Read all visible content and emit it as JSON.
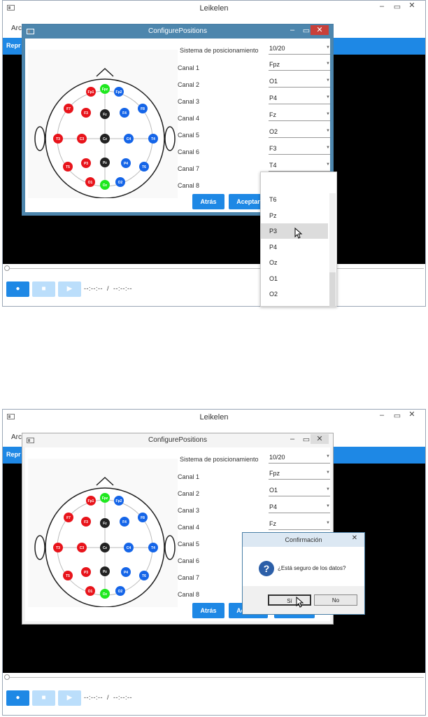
{
  "app": {
    "title": "Leikelen",
    "menu_label": "Arc",
    "blue_label": "Repr"
  },
  "window_controls": {
    "minimize": "–",
    "maximize": "▭",
    "close": "✕"
  },
  "player": {
    "time_current": "--:--:--",
    "time_sep": "/",
    "time_total": "--:--:--"
  },
  "config": {
    "title": "ConfigurePositions",
    "system_label": "Sistema de posicionamiento",
    "system_value": "10/20",
    "channels": [
      {
        "label": "Canal 1",
        "value": "Fpz"
      },
      {
        "label": "Canal 2",
        "value": "O1"
      },
      {
        "label": "Canal 3",
        "value": "P4"
      },
      {
        "label": "Canal 4",
        "value": "Fz"
      },
      {
        "label": "Canal 5",
        "value": "O2"
      },
      {
        "label": "Canal 6",
        "value": "F3"
      },
      {
        "label": "Canal 7",
        "value": "T4"
      },
      {
        "label": "Canal 8",
        "value": ""
      }
    ],
    "back_button": "Atrás",
    "accept_button": "Aceptar",
    "accept_button_short": "Ac"
  },
  "dropdown_options": [
    "T6",
    "Pz",
    "P3",
    "P4",
    "Oz",
    "O1",
    "O2"
  ],
  "dropdown_highlighted": "P3",
  "electrodes": [
    {
      "name": "Fp1",
      "color": "red"
    },
    {
      "name": "Fpz",
      "color": "green"
    },
    {
      "name": "Fp2",
      "color": "blue"
    },
    {
      "name": "F7",
      "color": "red"
    },
    {
      "name": "F3",
      "color": "red"
    },
    {
      "name": "Fz",
      "color": "black"
    },
    {
      "name": "F4",
      "color": "blue"
    },
    {
      "name": "F8",
      "color": "blue"
    },
    {
      "name": "T3",
      "color": "red"
    },
    {
      "name": "C3",
      "color": "red"
    },
    {
      "name": "Cz",
      "color": "black"
    },
    {
      "name": "C4",
      "color": "blue"
    },
    {
      "name": "T4",
      "color": "blue"
    },
    {
      "name": "T5",
      "color": "red"
    },
    {
      "name": "P3",
      "color": "red"
    },
    {
      "name": "Pz",
      "color": "black"
    },
    {
      "name": "P4",
      "color": "blue"
    },
    {
      "name": "T6",
      "color": "blue"
    },
    {
      "name": "O1",
      "color": "red"
    },
    {
      "name": "Oz",
      "color": "green"
    },
    {
      "name": "O2",
      "color": "blue"
    }
  ],
  "confirm": {
    "title": "Confirmación",
    "message": "¿Está seguro de los datos?",
    "yes": "Sí",
    "no": "No",
    "close": "✕"
  },
  "colors": {
    "accent": "#1e88e5",
    "red": "#e8141b",
    "green": "#1ee81e",
    "blue": "#1565e8",
    "black": "#222222"
  }
}
